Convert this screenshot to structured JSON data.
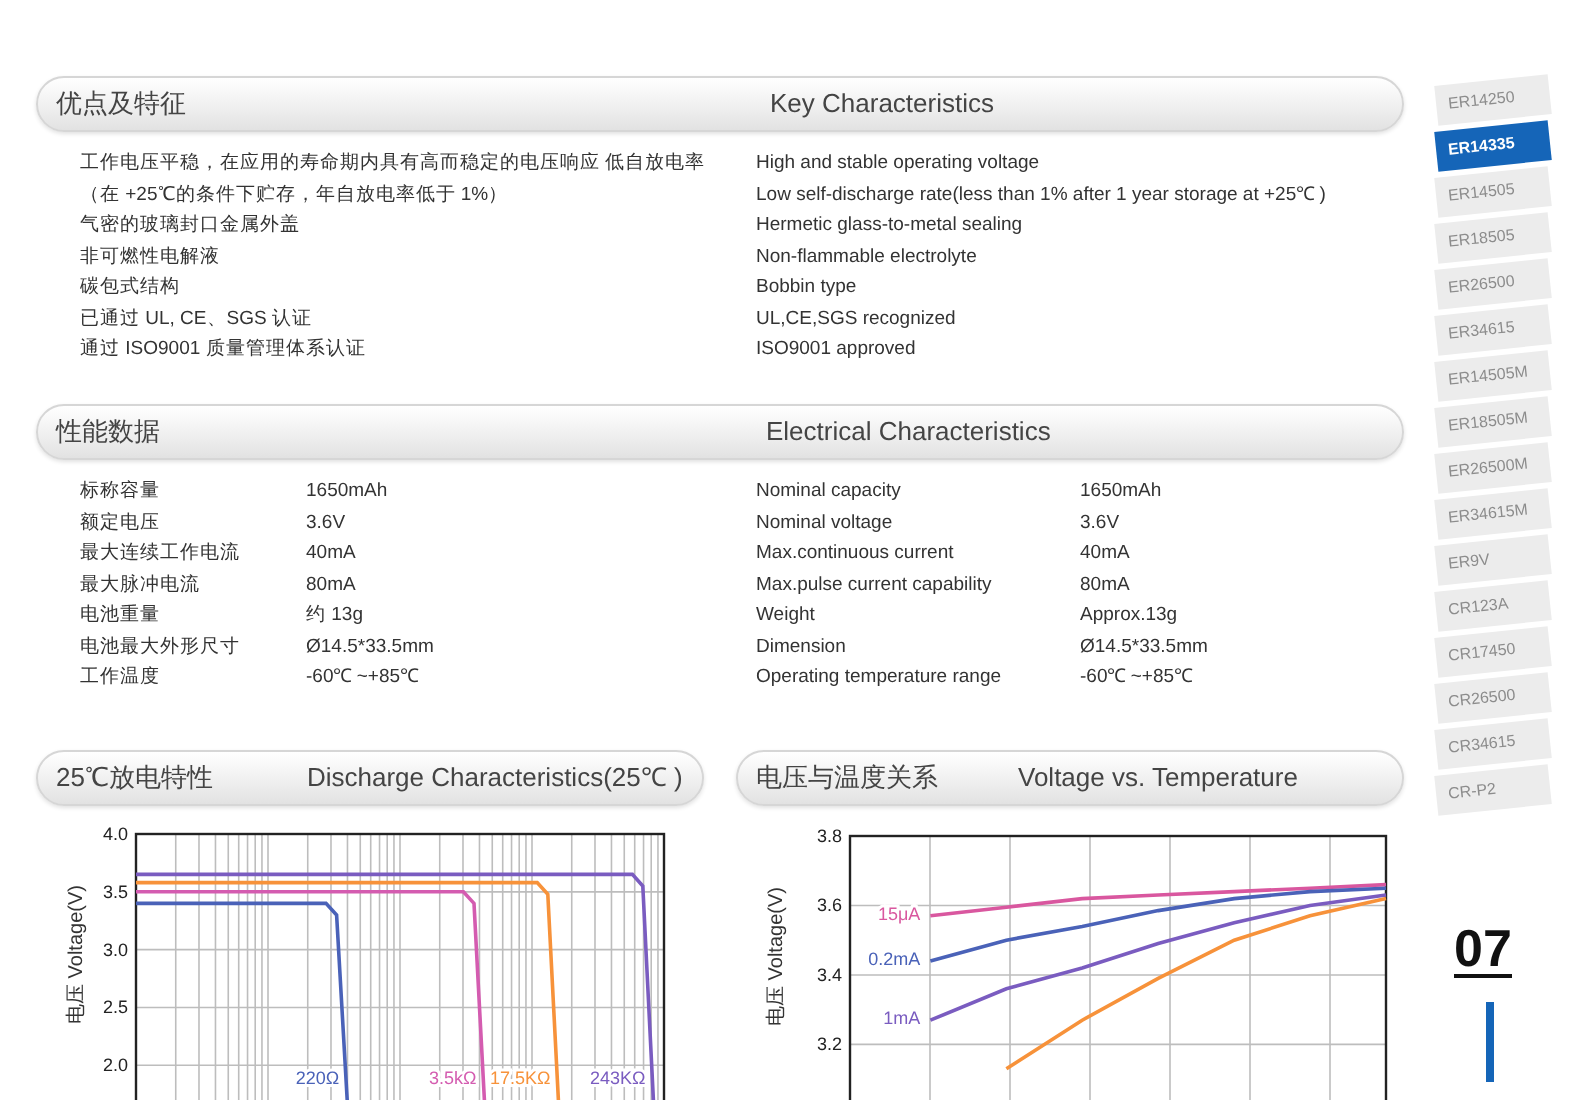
{
  "key_characteristics": {
    "title_zh": "优点及特征",
    "title_en": "Key Characteristics",
    "items_zh": [
      "工作电压平稳，在应用的寿命期内具有高而稳定的电压响应 低自放电率（在 +25℃的条件下贮存，年自放电率低于 1%）",
      "气密的玻璃封口金属外盖",
      "非可燃性电解液",
      "碳包式结构",
      "已通过 UL, CE、SGS 认证",
      "通过 ISO9001 质量管理体系认证"
    ],
    "items_en": [
      "High and stable operating voltage",
      "Low self-discharge rate(less than 1% after 1 year storage at +25℃ )",
      "Hermetic glass-to-metal sealing",
      "Non-flammable electrolyte",
      "Bobbin type",
      "UL,CE,SGS recognized",
      "ISO9001 approved"
    ]
  },
  "electrical_characteristics": {
    "title_zh": "性能数据",
    "title_en": "Electrical Characteristics",
    "rows_zh": [
      {
        "label": "标称容量",
        "value": "1650mAh"
      },
      {
        "label": "额定电压",
        "value": "3.6V"
      },
      {
        "label": "最大连续工作电流",
        "value": "40mA"
      },
      {
        "label": "最大脉冲电流",
        "value": "80mA"
      },
      {
        "label": "电池重量",
        "value": "约 13g"
      },
      {
        "label": "电池最大外形尺寸",
        "value": "Ø14.5*33.5mm"
      },
      {
        "label": "工作温度",
        "value": "-60℃ ~+85℃"
      }
    ],
    "rows_en": [
      {
        "label": "Nominal capacity",
        "value": "1650mAh"
      },
      {
        "label": "Nominal voltage",
        "value": "3.6V"
      },
      {
        "label": "Max.continuous current",
        "value": "40mA"
      },
      {
        "label": "Max.pulse current capability",
        "value": "80mA"
      },
      {
        "label": "Weight",
        "value": "Approx.13g"
      },
      {
        "label": "Dimension",
        "value": "Ø14.5*33.5mm"
      },
      {
        "label": "Operating temperature range",
        "value": "-60℃ ~+85℃"
      }
    ]
  },
  "discharge": {
    "title_zh": "25℃放电特性",
    "title_en": "Discharge Characteristics(25℃ )",
    "chart_data": {
      "type": "line",
      "grid": true,
      "ylabel": "电压 Voltage(V)",
      "ylim": [
        1.7,
        4.0
      ],
      "yticks": [
        {
          "value": 2.0,
          "label": "2.0"
        },
        {
          "value": 2.5,
          "label": "2.5"
        },
        {
          "value": 3.0,
          "label": "3.0"
        },
        {
          "value": 3.5,
          "label": "3.5"
        },
        {
          "value": 4.0,
          "label": "4.0"
        }
      ],
      "categories": [
        null,
        null,
        null,
        null,
        null,
        null,
        null,
        null,
        null,
        null,
        null,
        null,
        null,
        null,
        null,
        null,
        null,
        null,
        null,
        null,
        null,
        null,
        null,
        null,
        null,
        null,
        null,
        null,
        null,
        null,
        null,
        null,
        null,
        null,
        null,
        null,
        null,
        null,
        null,
        null,
        null,
        null,
        null,
        null,
        null,
        null,
        null,
        null,
        null,
        null,
        null
      ],
      "series": [
        {
          "name": "220Ω",
          "color": "#4a62b8",
          "values": [
            3.4,
            3.4,
            3.4,
            3.4,
            3.4,
            3.4,
            3.4,
            3.4,
            3.4,
            3.4,
            3.4,
            3.4,
            3.4,
            3.4,
            3.4,
            3.4,
            3.4,
            3.4,
            3.4,
            3.3,
            1.7,
            null,
            null,
            null,
            null,
            null,
            null,
            null,
            null,
            null,
            null,
            null,
            null,
            null,
            null,
            null,
            null,
            null,
            null,
            null,
            null,
            null,
            null,
            null,
            null,
            null,
            null,
            null,
            null,
            null,
            null
          ]
        },
        {
          "name": "3.5kΩ",
          "color": "#d45cb0",
          "values": [
            3.5,
            3.5,
            3.5,
            3.5,
            3.5,
            3.5,
            3.5,
            3.5,
            3.5,
            3.5,
            3.5,
            3.5,
            3.5,
            3.5,
            3.5,
            3.5,
            3.5,
            3.5,
            3.5,
            3.5,
            3.5,
            3.5,
            3.5,
            3.5,
            3.5,
            3.5,
            3.5,
            3.5,
            3.5,
            3.5,
            3.5,
            3.5,
            3.4,
            1.7,
            null,
            null,
            null,
            null,
            null,
            null,
            null,
            null,
            null,
            null,
            null,
            null,
            null,
            null,
            null,
            null,
            null
          ]
        },
        {
          "name": "17.5KΩ",
          "color": "#f7923a",
          "values": [
            3.58,
            3.58,
            3.58,
            3.58,
            3.58,
            3.58,
            3.58,
            3.58,
            3.58,
            3.58,
            3.58,
            3.58,
            3.58,
            3.58,
            3.58,
            3.58,
            3.58,
            3.58,
            3.58,
            3.58,
            3.58,
            3.58,
            3.58,
            3.58,
            3.58,
            3.58,
            3.58,
            3.58,
            3.58,
            3.58,
            3.58,
            3.58,
            3.58,
            3.58,
            3.58,
            3.58,
            3.58,
            3.58,
            3.58,
            3.48,
            1.7,
            null,
            null,
            null,
            null,
            null,
            null,
            null,
            null,
            null,
            null
          ]
        },
        {
          "name": "243KΩ",
          "color": "#7a5cc0",
          "values": [
            3.65,
            3.65,
            3.65,
            3.65,
            3.65,
            3.65,
            3.65,
            3.65,
            3.65,
            3.65,
            3.65,
            3.65,
            3.65,
            3.65,
            3.65,
            3.65,
            3.65,
            3.65,
            3.65,
            3.65,
            3.65,
            3.65,
            3.65,
            3.65,
            3.65,
            3.65,
            3.65,
            3.65,
            3.65,
            3.65,
            3.65,
            3.65,
            3.65,
            3.65,
            3.65,
            3.65,
            3.65,
            3.65,
            3.65,
            3.65,
            3.65,
            3.65,
            3.65,
            3.65,
            3.65,
            3.65,
            3.65,
            3.65,
            3.55,
            1.7,
            null
          ]
        }
      ]
    }
  },
  "voltage_temperature": {
    "title_zh": "电压与温度关系",
    "title_en": "Voltage vs. Temperature",
    "chart_data": {
      "type": "line",
      "grid": true,
      "ylabel": "电压 Voltage(V)",
      "ylim": [
        3.04,
        3.8
      ],
      "yticks": [
        {
          "value": 3.2,
          "label": "3.2"
        },
        {
          "value": 3.4,
          "label": "3.4"
        },
        {
          "value": 3.6,
          "label": "3.6"
        },
        {
          "value": 3.8,
          "label": "3.8"
        }
      ],
      "categories": [
        null,
        null,
        null,
        null,
        null,
        null,
        null
      ],
      "series": [
        {
          "name": "15μA",
          "color": "#d9579f",
          "values": [
            3.57,
            3.595,
            3.62,
            3.63,
            3.64,
            3.65,
            3.66
          ]
        },
        {
          "name": "0.2mA",
          "color": "#4a62b8",
          "values": [
            3.44,
            3.5,
            3.54,
            3.585,
            3.62,
            3.64,
            3.65
          ]
        },
        {
          "name": "1mA",
          "color": "#7a5cc0",
          "values": [
            3.27,
            3.36,
            3.42,
            3.49,
            3.55,
            3.6,
            3.63
          ]
        },
        {
          "color": "#f7923a",
          "values": [
            null,
            3.13,
            3.27,
            3.39,
            3.5,
            3.57,
            3.62
          ]
        }
      ]
    }
  },
  "model_tabs": [
    {
      "label": "ER14250",
      "selected": false
    },
    {
      "label": "ER14335",
      "selected": true
    },
    {
      "label": "ER14505",
      "selected": false
    },
    {
      "label": "ER18505",
      "selected": false
    },
    {
      "label": "ER26500",
      "selected": false
    },
    {
      "label": "ER34615",
      "selected": false
    },
    {
      "label": "ER14505M",
      "selected": false
    },
    {
      "label": "ER18505M",
      "selected": false
    },
    {
      "label": "ER26500M",
      "selected": false
    },
    {
      "label": "ER34615M",
      "selected": false
    },
    {
      "label": "ER9V",
      "selected": false
    },
    {
      "label": "CR123A",
      "selected": false
    },
    {
      "label": "CR17450",
      "selected": false
    },
    {
      "label": "CR26500",
      "selected": false
    },
    {
      "label": "CR34615",
      "selected": false
    },
    {
      "label": "CR-P2",
      "selected": false
    }
  ],
  "page_number": "07"
}
